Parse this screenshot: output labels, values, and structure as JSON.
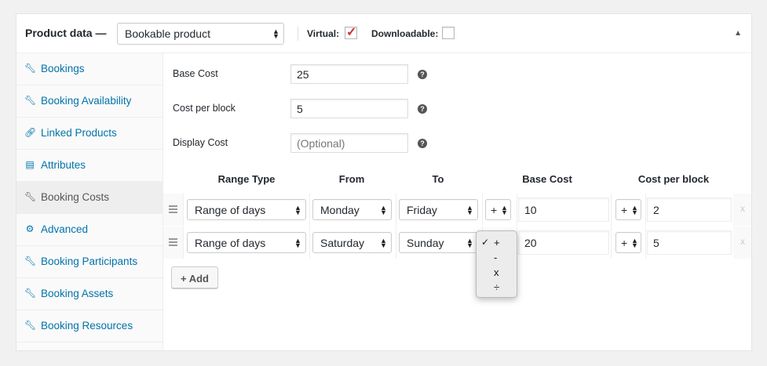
{
  "header": {
    "title": "Product data —",
    "product_type": "Bookable product",
    "virtual_label": "Virtual:",
    "virtual_checked": true,
    "downloadable_label": "Downloadable:",
    "downloadable_checked": false,
    "toggle_icon": "triangle-up-icon"
  },
  "sidebar": {
    "items": [
      {
        "label": "Bookings",
        "icon": "wrench-icon"
      },
      {
        "label": "Booking Availability",
        "icon": "wrench-icon"
      },
      {
        "label": "Linked Products",
        "icon": "link-icon"
      },
      {
        "label": "Attributes",
        "icon": "list-icon"
      },
      {
        "label": "Booking Costs",
        "icon": "wrench-icon",
        "active": true
      },
      {
        "label": "Advanced",
        "icon": "gear-icon"
      },
      {
        "label": "Booking Participants",
        "icon": "wrench-icon"
      },
      {
        "label": "Booking Assets",
        "icon": "wrench-icon"
      },
      {
        "label": "Booking Resources",
        "icon": "wrench-icon"
      }
    ]
  },
  "fields": {
    "base_cost": {
      "label": "Base Cost",
      "value": "25"
    },
    "cost_per_block": {
      "label": "Cost per block",
      "value": "5"
    },
    "display_cost": {
      "label": "Display Cost",
      "placeholder": "(Optional)"
    }
  },
  "table": {
    "headers": [
      "Range Type",
      "From",
      "To",
      "Base Cost",
      "Cost per block"
    ],
    "rows": [
      {
        "range_type": "Range of days",
        "from": "Monday",
        "to": "Friday",
        "base_op": "+",
        "base_cost": "10",
        "block_op": "+",
        "block_cost": "2",
        "remove": "x"
      },
      {
        "range_type": "Range of days",
        "from": "Saturday",
        "to": "Sunday",
        "base_op": "+",
        "base_cost": "20",
        "block_op": "+",
        "block_cost": "5",
        "remove": "x"
      }
    ]
  },
  "add_button": "+ Add",
  "operator_dropdown": {
    "options": [
      "+",
      "-",
      "x",
      "÷"
    ],
    "selected": "+"
  },
  "colors": {
    "link": "#0073aa",
    "active_bg": "#eeeeee",
    "checkmark": "#d0312d"
  }
}
